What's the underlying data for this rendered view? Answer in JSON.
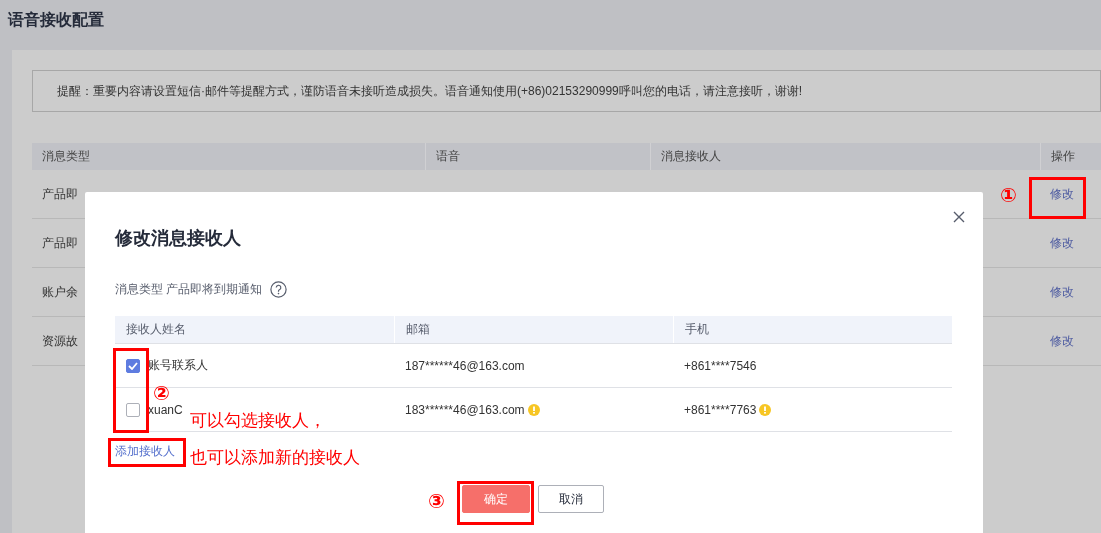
{
  "page": {
    "title": "语音接收配置"
  },
  "notice": "提醒：重要内容请设置短信·邮件等提醒方式，谨防语音未接听造成损失。语音通知使用(+86)02153290999呼叫您的电话，请注意接听，谢谢!",
  "table": {
    "columns": [
      "消息类型",
      "语音",
      "消息接收人",
      "操作"
    ],
    "rows": [
      {
        "message_type": "产品即",
        "action": "修改"
      },
      {
        "message_type": "产品即",
        "action": "修改"
      },
      {
        "message_type": "账户余",
        "action": "修改"
      },
      {
        "message_type": "资源故",
        "action": "修改"
      }
    ]
  },
  "dialog": {
    "title": "修改消息接收人",
    "message_type_label": "消息类型 产品即将到期通知",
    "columns": [
      "接收人姓名",
      "邮箱",
      "手机"
    ],
    "rows": [
      {
        "name": "账号联系人",
        "email": "187******46@163.com",
        "phone": "+861****7546",
        "checked": true,
        "email_warning": false,
        "phone_warning": false
      },
      {
        "name": "xuanC",
        "email": "183******46@163.com",
        "phone": "+861****7763",
        "checked": false,
        "email_warning": true,
        "phone_warning": true
      }
    ],
    "add_link": "添加接收人",
    "buttons": [
      {
        "label": "确定",
        "kind": "primary"
      },
      {
        "label": "取消",
        "kind": "default"
      }
    ]
  },
  "annotations": {
    "markers": [
      "①",
      "②",
      "③"
    ],
    "notes": [
      "可以勾选接收人，",
      "也可以添加新的接收人"
    ]
  }
}
